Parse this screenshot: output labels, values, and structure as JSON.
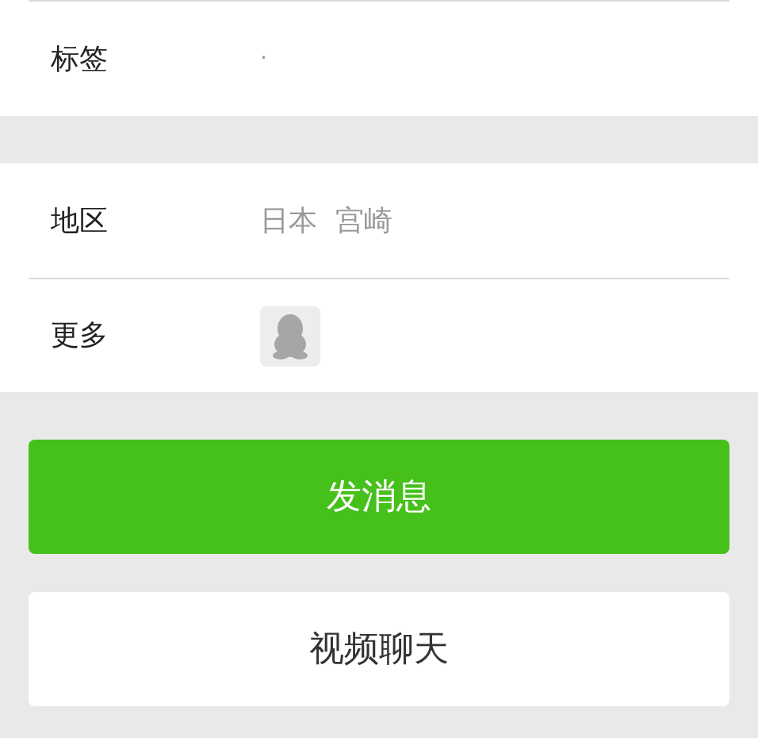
{
  "tag_row": {
    "label": "标签",
    "value": "·"
  },
  "info_rows": [
    {
      "kind": "text",
      "label": "地区",
      "value": "日本  宫崎"
    },
    {
      "kind": "icon",
      "label": "更多"
    }
  ],
  "buttons": [
    {
      "kind": "primary",
      "label": "发消息"
    },
    {
      "kind": "secondary",
      "label": "视频聊天"
    }
  ]
}
